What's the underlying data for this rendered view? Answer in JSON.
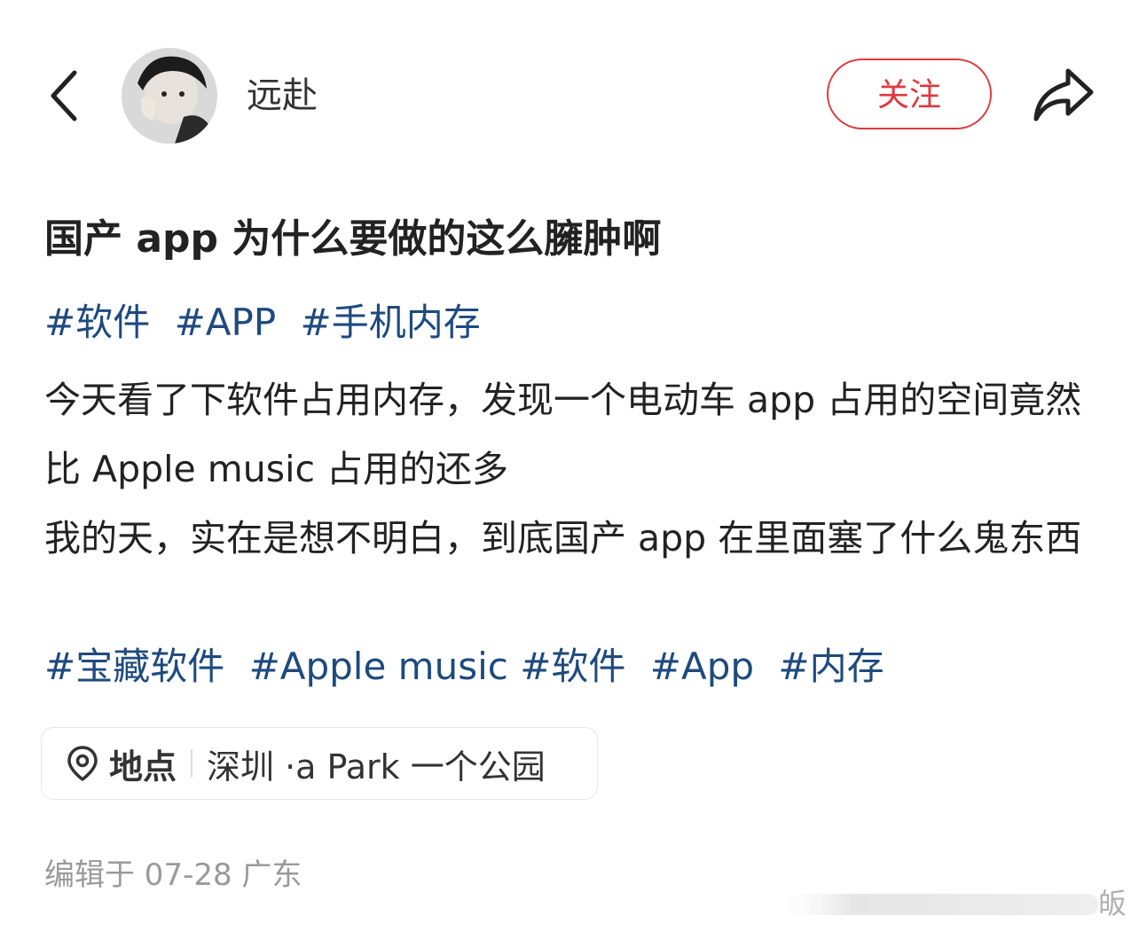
{
  "header": {
    "username": "远赴",
    "follow_label": "关注"
  },
  "post": {
    "title": "国产 app 为什么要做的这么臃肿啊",
    "tags_top": [
      "#软件",
      "#APP",
      "#手机内存"
    ],
    "body_lines": [
      "今天看了下软件占用内存，发现一个电动车 app 占用的空间竟然比 Apple music 占用的还多",
      "我的天，实在是想不明白，到底国产 app 在里面塞了什么鬼东西"
    ],
    "tags_bottom": [
      "#宝藏软件",
      "#Apple music",
      "#软件",
      "#App",
      "#内存"
    ]
  },
  "location": {
    "label": "地点",
    "value": "深圳 ·a Park 一个公园"
  },
  "meta": {
    "edited": "编辑于 07-28 广东"
  },
  "watermark": {
    "text": "皈"
  },
  "colors": {
    "accent_red": "#e0383e",
    "tag_blue": "#1e4a7e",
    "meta_gray": "#9a9a9a"
  }
}
